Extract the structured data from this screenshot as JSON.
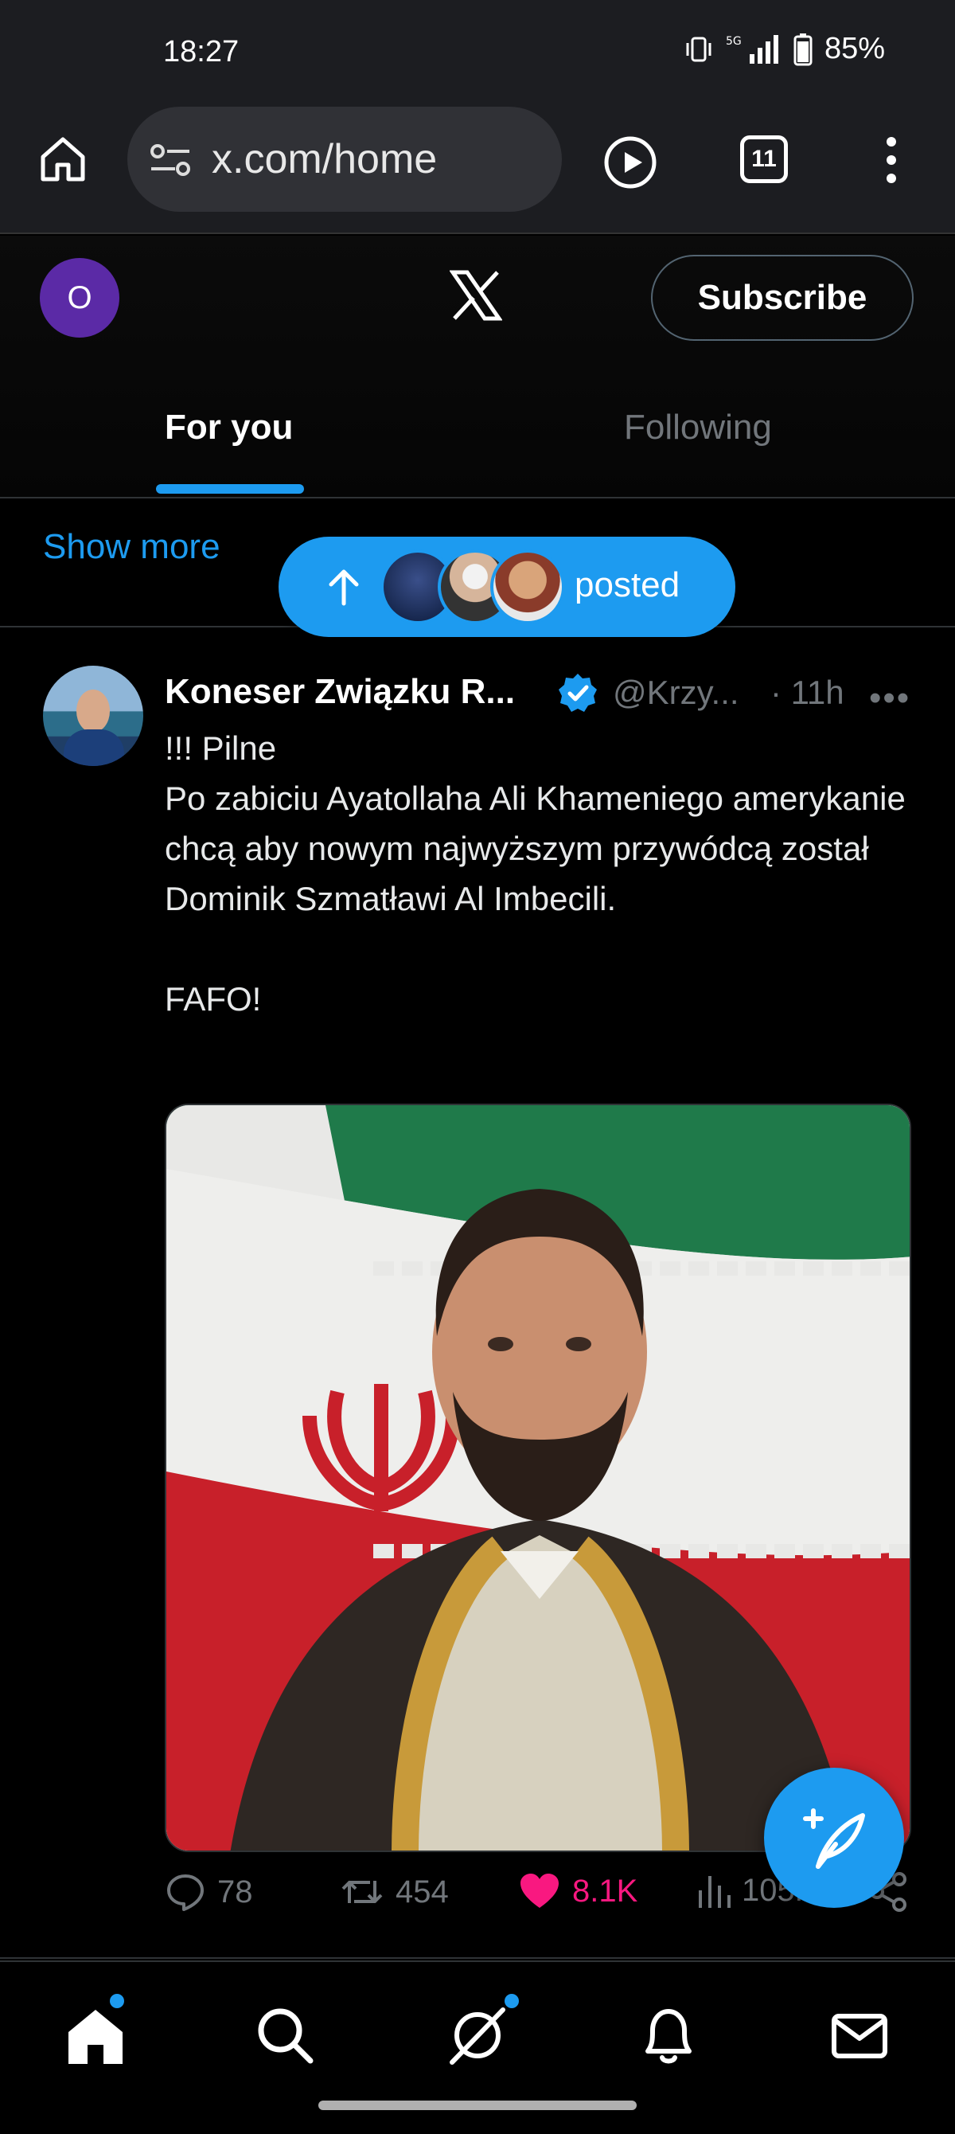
{
  "status_bar": {
    "time": "18:27",
    "network": "5G",
    "battery": "85%"
  },
  "browser": {
    "url": "x.com/home",
    "tab_count": "11"
  },
  "header": {
    "avatar_initial": "O",
    "logo_icon": "x-logo-icon",
    "subscribe_label": "Subscribe",
    "tabs": [
      {
        "label": "For you",
        "active": true
      },
      {
        "label": "Following",
        "active": false
      }
    ]
  },
  "feed": {
    "show_more_label": "Show more",
    "new_posts_pill": {
      "label": "posted"
    }
  },
  "tweet": {
    "author_name": "Koneser Związku R...",
    "handle": "@Krzy...",
    "time": "· 11h",
    "more_label": "•••",
    "text": "!!! Pilne\nPo zabiciu Ayatollaha Ali Khameniego amerykanie chcą aby nowym najwyższym przywódcą został Dominik Szmatławi Al Imbecili.\n\nFAFO!",
    "media_description_icon": "portrait-photo-iran-flag",
    "stats": {
      "replies": "78",
      "reposts": "454",
      "likes": "8.1K",
      "views": "105K"
    }
  },
  "colors": {
    "accent": "#1d9bf0",
    "like": "#f91880",
    "muted": "#71767b",
    "avatar_bg": "#5b2aa6"
  },
  "bottom_nav": [
    {
      "icon": "home-icon",
      "badge": true
    },
    {
      "icon": "search-icon",
      "badge": false
    },
    {
      "icon": "grok-icon",
      "badge": true
    },
    {
      "icon": "bell-icon",
      "badge": false
    },
    {
      "icon": "mail-icon",
      "badge": false
    }
  ]
}
